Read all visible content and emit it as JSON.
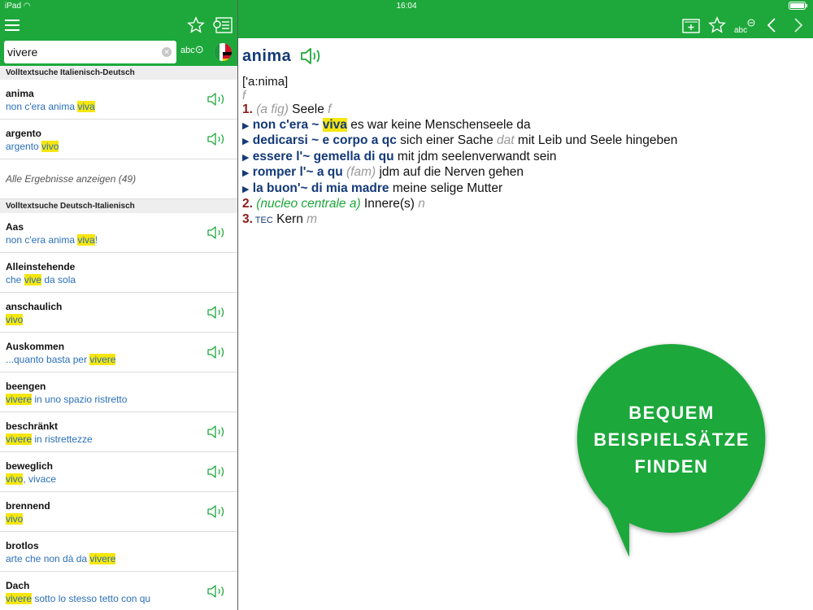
{
  "status": {
    "device": "iPad",
    "time": "16:04"
  },
  "search": {
    "value": "vivere",
    "abc_label": "abc"
  },
  "colors": {
    "brand_green": "#1ea83b",
    "highlight": "#f6e60e",
    "headword_blue": "#143a78",
    "example_blue": "#2a6fb8",
    "sense_num": "#8b1d1d"
  },
  "left": {
    "icons": [
      "menu-icon",
      "star-icon",
      "list-icon"
    ],
    "section1": "Volltextsuche Italienisch-Deutsch",
    "results1": [
      {
        "hw": "anima",
        "pre": "non c'era anima ",
        "hl": "viva",
        "post": "",
        "audio": true
      },
      {
        "hw": "argento",
        "pre": "argento ",
        "hl": "vivo",
        "post": "",
        "audio": true
      }
    ],
    "more1": "Alle Ergebnisse anzeigen (49)",
    "section2": "Volltextsuche Deutsch-Italienisch",
    "results2": [
      {
        "hw": "Aas",
        "pre": "non c'era anima ",
        "hl": "viva",
        "post": "!",
        "audio": true
      },
      {
        "hw": "Alleinstehende",
        "pre": "che ",
        "hl": "vive",
        "post": " da sola",
        "audio": false
      },
      {
        "hw": "anschaulich",
        "pre": "",
        "hl": "vivo",
        "post": "",
        "audio": true
      },
      {
        "hw": "Auskommen",
        "pre": "...quanto basta per ",
        "hl": "vivere",
        "post": "",
        "audio": true
      },
      {
        "hw": "beengen",
        "pre": "",
        "hl": "vivere",
        "post": " in uno spazio ristretto",
        "audio": false
      },
      {
        "hw": "beschränkt",
        "pre": "",
        "hl": "vivere",
        "post": " in ristrettezze",
        "audio": true
      },
      {
        "hw": "beweglich",
        "pre": "",
        "hl": "vivo",
        "post": ", vivace",
        "audio": true
      },
      {
        "hw": "brennend",
        "pre": "",
        "hl": "vivo",
        "post": "",
        "audio": true
      },
      {
        "hw": "brotlos",
        "pre": "arte che non dà da ",
        "hl": "vivere",
        "post": "",
        "audio": false
      },
      {
        "hw": "Dach",
        "pre": "",
        "hl": "vivere",
        "post": " sotto lo stesso tetto con qu",
        "audio": true
      }
    ]
  },
  "right": {
    "icons": [
      "add-to-list-icon",
      "favorite-star-icon",
      "abc-zoom-out-icon",
      "back-chevron-icon",
      "forward-chevron-icon"
    ],
    "abc_label": "abc",
    "headword": "anima",
    "pronunciation": "['a:nima]",
    "gender": "f",
    "s1": {
      "num": "1.",
      "label": "(a fig)",
      "tr": " Seele ",
      "g": "f"
    },
    "e1": {
      "pre": "non c'era ~ ",
      "hl": "viva",
      "tr": " es war keine Menschenseele da"
    },
    "e2": {
      "ph": "dedicarsi ~ e corpo a qc",
      "tr1": " sich einer Sache ",
      "it": "dat",
      "tr2": " mit Leib und Seele hingeben"
    },
    "e3": {
      "ph": "essere l'~ gemella di qu",
      "tr": " mit jdm seelenverwandt sein"
    },
    "e4": {
      "ph": "romper l'~ a qu",
      "it": " (fam)",
      "tr": " jdm auf die Nerven gehen"
    },
    "e5": {
      "ph": "la buon'~ di mia madre",
      "tr": " meine selige Mutter"
    },
    "s2": {
      "num": "2.",
      "label": " (nucleo centrale a)",
      "tr": " Innere(s) ",
      "g": "n"
    },
    "s3": {
      "num": "3.",
      "domain": " TEC",
      "tr": " Kern ",
      "g": "m"
    }
  },
  "promo": {
    "line1": "BEQUEM",
    "line2": "BEISPIELSÄTZE",
    "line3": "FINDEN"
  }
}
